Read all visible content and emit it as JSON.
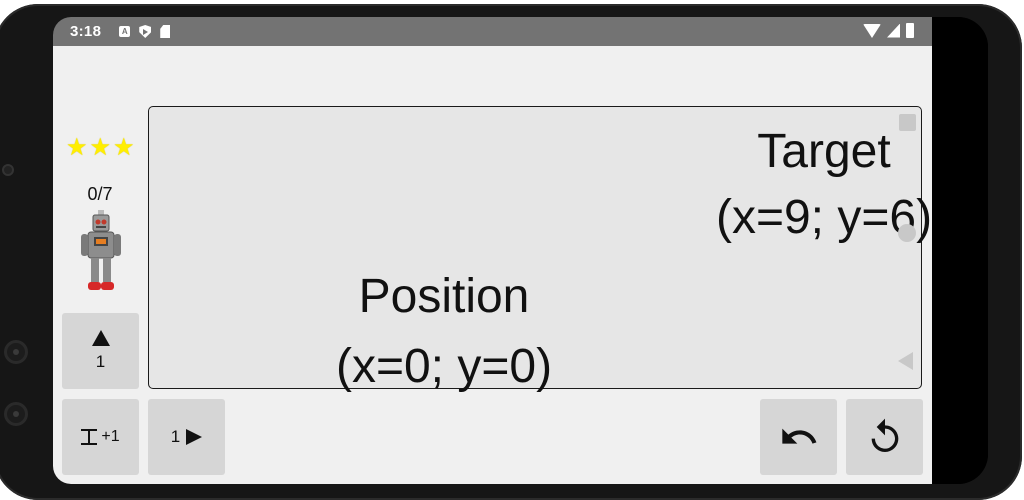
{
  "status_bar": {
    "time": "3:18",
    "icons": [
      "a-badge-icon",
      "shield-play-icon",
      "sd-card-icon",
      "wifi-icon",
      "signal-icon",
      "battery-icon"
    ],
    "notification_letter": "A"
  },
  "game": {
    "stars_count": 3,
    "star_symbol": "★",
    "score": "0/7",
    "target_label": "Target",
    "target_coords": "(x=9; y=6)",
    "position_label": "Position",
    "position_coords": "(x=0; y=0)"
  },
  "controls": {
    "up_count": "1",
    "expand_label": "+1",
    "right_count": "1"
  },
  "colors": {
    "star": "#ffee00",
    "board": "#e6e6e6",
    "button": "#d6d6d6",
    "status_bar": "#737373",
    "app_background": "#f0f0f0"
  }
}
